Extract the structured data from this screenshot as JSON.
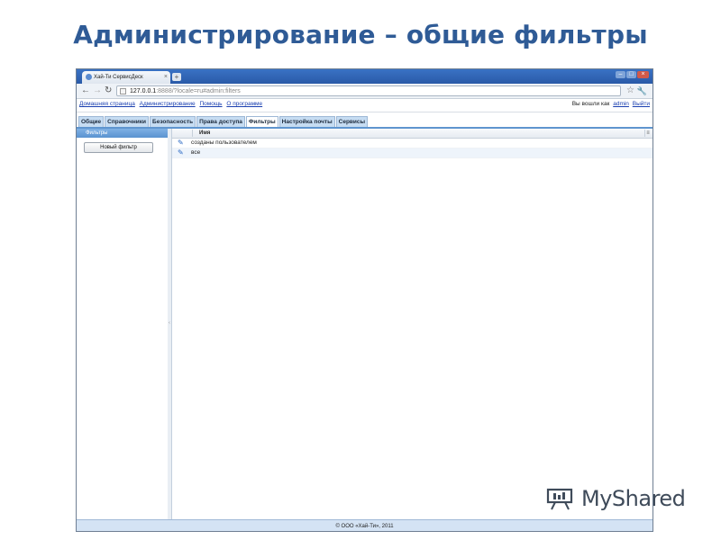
{
  "slide": {
    "title": "Администрирование – общие фильтры"
  },
  "browser": {
    "tab_title": "Хай-Ти СервисДеск",
    "tab_close": "×",
    "new_tab": "+",
    "url_host": "127.0.0.1",
    "url_rest": ":8888/?locale=ru#admin:filters"
  },
  "menu": {
    "home": "Домашняя страница",
    "admin": "Администрирование",
    "help": "Помощь",
    "about": "О программе",
    "logged_in_as": "Вы вошли как",
    "username": "admin",
    "logout": "Выйти"
  },
  "tabs": [
    "Общие",
    "Справочники",
    "Безопасность",
    "Права доступа",
    "Фильтры",
    "Настройка почты",
    "Сервисы"
  ],
  "active_tab": "Фильтры",
  "sidebar": {
    "header": "Фильтры",
    "new_filter_button": "Новый фильтр"
  },
  "grid": {
    "column_header": "Имя",
    "rows": [
      {
        "label": "созданы пользователем"
      },
      {
        "label": "все"
      }
    ]
  },
  "footer": {
    "copyright": "© ООО «Хай-Ти», 2011"
  },
  "watermark": {
    "text": "MyShared"
  }
}
